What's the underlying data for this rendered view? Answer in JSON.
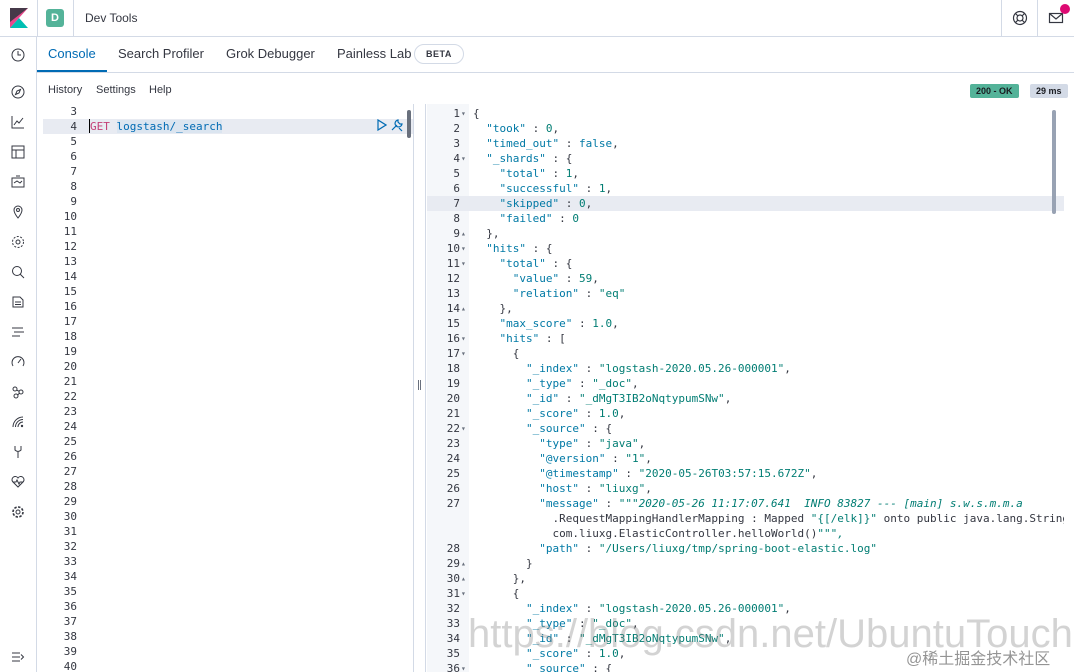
{
  "header": {
    "space_initial": "D",
    "app_title": "Dev Tools",
    "colors": {
      "accent": "#006bb4",
      "space": "#54b399",
      "notification": "#dd0a73"
    },
    "icons": [
      "kibana-logo-icon",
      "help-icon",
      "newsfeed-mail-icon"
    ]
  },
  "sidenav": {
    "icons": [
      "recently-viewed-clock-icon",
      "discover-compass-icon",
      "visualize-icon",
      "dashboard-icon",
      "canvas-icon",
      "maps-icon",
      "machine-learning-icon",
      "metrics-icon",
      "logs-icon",
      "apm-icon",
      "uptime-icon",
      "siem-icon",
      "dev-tools-icon",
      "stack-monitoring-icon",
      "management-gear-icon",
      "collapse-nav-icon"
    ]
  },
  "tabs": [
    {
      "label": "Console",
      "active": true
    },
    {
      "label": "Search Profiler",
      "active": false
    },
    {
      "label": "Grok Debugger",
      "active": false
    },
    {
      "label": "Painless Lab",
      "active": false
    }
  ],
  "beta_label": "BETA",
  "subbar": {
    "history": "History",
    "settings": "Settings",
    "help": "Help"
  },
  "response_status": {
    "status": "200 - OK",
    "time": "29 ms",
    "status_color": "#54b399",
    "time_color": "#d3dae6"
  },
  "editor": {
    "line_numbers": [
      "3",
      "4",
      "5",
      "6",
      "7",
      "8",
      "9",
      "10",
      "11",
      "12",
      "13",
      "14",
      "15",
      "16",
      "17",
      "18",
      "19",
      "20",
      "21",
      "22",
      "23",
      "24",
      "25",
      "26",
      "27",
      "28",
      "29",
      "30",
      "31",
      "32",
      "33",
      "34",
      "35",
      "36",
      "37",
      "38",
      "39",
      "40"
    ],
    "request_method": "GET",
    "request_path": "logstash/_search",
    "active_line": "4"
  },
  "output": {
    "lines": [
      {
        "n": "1",
        "fold": "▾",
        "code": "{"
      },
      {
        "n": "2",
        "fold": "",
        "code": "  \"took\" : 0,"
      },
      {
        "n": "3",
        "fold": "",
        "code": "  \"timed_out\" : false,"
      },
      {
        "n": "4",
        "fold": "▾",
        "code": "  \"_shards\" : {"
      },
      {
        "n": "5",
        "fold": "",
        "code": "    \"total\" : 1,"
      },
      {
        "n": "6",
        "fold": "",
        "code": "    \"successful\" : 1,"
      },
      {
        "n": "7",
        "fold": "",
        "code": "    \"skipped\" : 0,"
      },
      {
        "n": "8",
        "fold": "",
        "code": "    \"failed\" : 0"
      },
      {
        "n": "9",
        "fold": "▴",
        "code": "  },"
      },
      {
        "n": "10",
        "fold": "▾",
        "code": "  \"hits\" : {"
      },
      {
        "n": "11",
        "fold": "▾",
        "code": "    \"total\" : {"
      },
      {
        "n": "12",
        "fold": "",
        "code": "      \"value\" : 59,"
      },
      {
        "n": "13",
        "fold": "",
        "code": "      \"relation\" : \"eq\""
      },
      {
        "n": "14",
        "fold": "▴",
        "code": "    },"
      },
      {
        "n": "15",
        "fold": "",
        "code": "    \"max_score\" : 1.0,"
      },
      {
        "n": "16",
        "fold": "▾",
        "code": "    \"hits\" : ["
      },
      {
        "n": "17",
        "fold": "▾",
        "code": "      {"
      },
      {
        "n": "18",
        "fold": "",
        "code": "        \"_index\" : \"logstash-2020.05.26-000001\","
      },
      {
        "n": "19",
        "fold": "",
        "code": "        \"_type\" : \"_doc\","
      },
      {
        "n": "20",
        "fold": "",
        "code": "        \"_id\" : \"_dMgT3IB2oNqtypumSNw\","
      },
      {
        "n": "21",
        "fold": "",
        "code": "        \"_score\" : 1.0,"
      },
      {
        "n": "22",
        "fold": "▾",
        "code": "        \"_source\" : {"
      },
      {
        "n": "23",
        "fold": "",
        "code": "          \"type\" : \"java\","
      },
      {
        "n": "24",
        "fold": "",
        "code": "          \"@version\" : \"1\","
      },
      {
        "n": "25",
        "fold": "",
        "code": "          \"@timestamp\" : \"2020-05-26T03:57:15.672Z\","
      },
      {
        "n": "26",
        "fold": "",
        "code": "          \"host\" : \"liuxg\","
      },
      {
        "n": "27",
        "fold": "",
        "code": "          \"message\" : \"\"\"2020-05-26 11:17:07.641  INFO 83827 --- [main] s.w.s.m.m.a"
      },
      {
        "n": "",
        "fold": "",
        "code": "            .RequestMappingHandlerMapping : Mapped \"{[/elk]}\" onto public java.lang.String"
      },
      {
        "n": "",
        "fold": "",
        "code": "            com.liuxg.ElasticController.helloWorld()\"\"\","
      },
      {
        "n": "28",
        "fold": "",
        "code": "          \"path\" : \"/Users/liuxg/tmp/spring-boot-elastic.log\""
      },
      {
        "n": "29",
        "fold": "▴",
        "code": "        }"
      },
      {
        "n": "30",
        "fold": "▴",
        "code": "      },"
      },
      {
        "n": "31",
        "fold": "▾",
        "code": "      {"
      },
      {
        "n": "32",
        "fold": "",
        "code": "        \"_index\" : \"logstash-2020.05.26-000001\","
      },
      {
        "n": "33",
        "fold": "",
        "code": "        \"_type\" : \"_doc\","
      },
      {
        "n": "34",
        "fold": "",
        "code": "        \"_id\" : \"_dMgT3IB2oNqtypumSNw\","
      },
      {
        "n": "35",
        "fold": "",
        "code": "        \"_score\" : 1.0,"
      },
      {
        "n": "36",
        "fold": "▾",
        "code": "        \"_source\" : {"
      }
    ],
    "active_line": "7"
  },
  "watermark": {
    "url": "https://blog.csdn.net/UbuntuTouch",
    "site": "@稀土掘金技术社区"
  }
}
